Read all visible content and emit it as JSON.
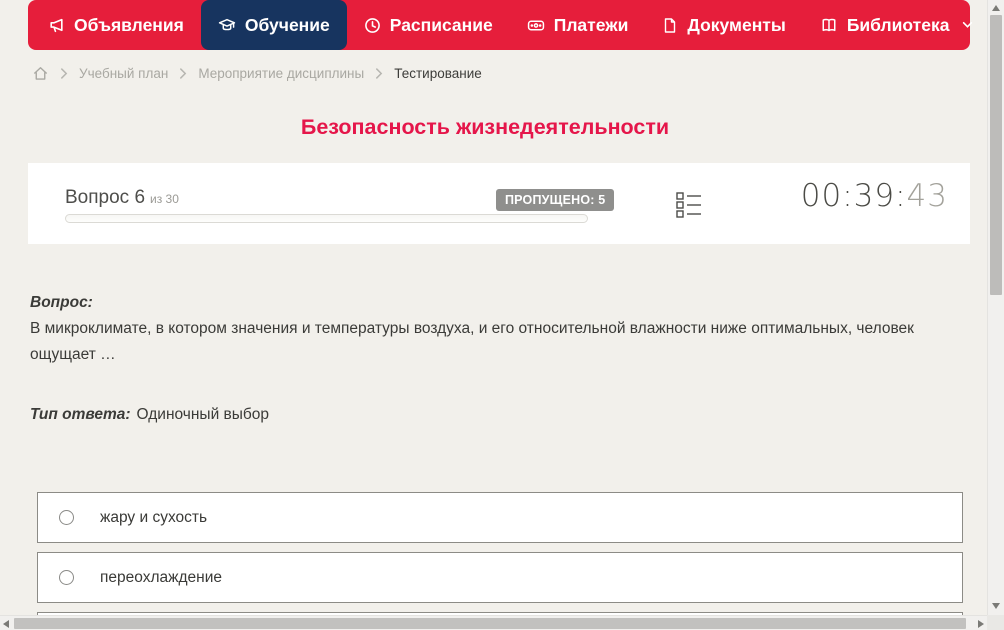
{
  "colors": {
    "brand_red": "#e61e3b",
    "active_navy": "#17345f",
    "title_red": "#e5164a",
    "page_bg": "#f2f0eb",
    "badge_gray": "#8f8f8d"
  },
  "nav": {
    "items": [
      {
        "label": "Объявления",
        "icon": "megaphone-icon",
        "active": false
      },
      {
        "label": "Обучение",
        "icon": "graduation-cap-icon",
        "active": true
      },
      {
        "label": "Расписание",
        "icon": "clock-icon",
        "active": false
      },
      {
        "label": "Платежи",
        "icon": "banknote-icon",
        "active": false
      },
      {
        "label": "Документы",
        "icon": "document-icon",
        "active": false
      },
      {
        "label": "Библиотека",
        "icon": "open-book-icon",
        "active": false,
        "has_dropdown": true
      }
    ]
  },
  "breadcrumb": {
    "items": [
      "Учебный план",
      "Мероприятие дисциплины",
      "Тестирование"
    ]
  },
  "page": {
    "title": "Безопасность жизнедеятельности"
  },
  "quiz_header": {
    "question_label": "Вопрос 6",
    "question_total": "из 30",
    "skipped_badge": "ПРОПУЩЕНО: 5",
    "timer_main": "00:39:",
    "timer_seconds": "43",
    "progress_percent": 0
  },
  "question": {
    "prompt_label": "Вопрос:",
    "text": "В микроклимате, в котором значения и температуры воздуха, и его относительной влажности ниже оптимальных, человек ощущает …",
    "answer_type_label": "Тип ответа:",
    "answer_type_value": "Одиночный выбор",
    "options": [
      "жару и сухость",
      "переохлаждение",
      ""
    ]
  }
}
